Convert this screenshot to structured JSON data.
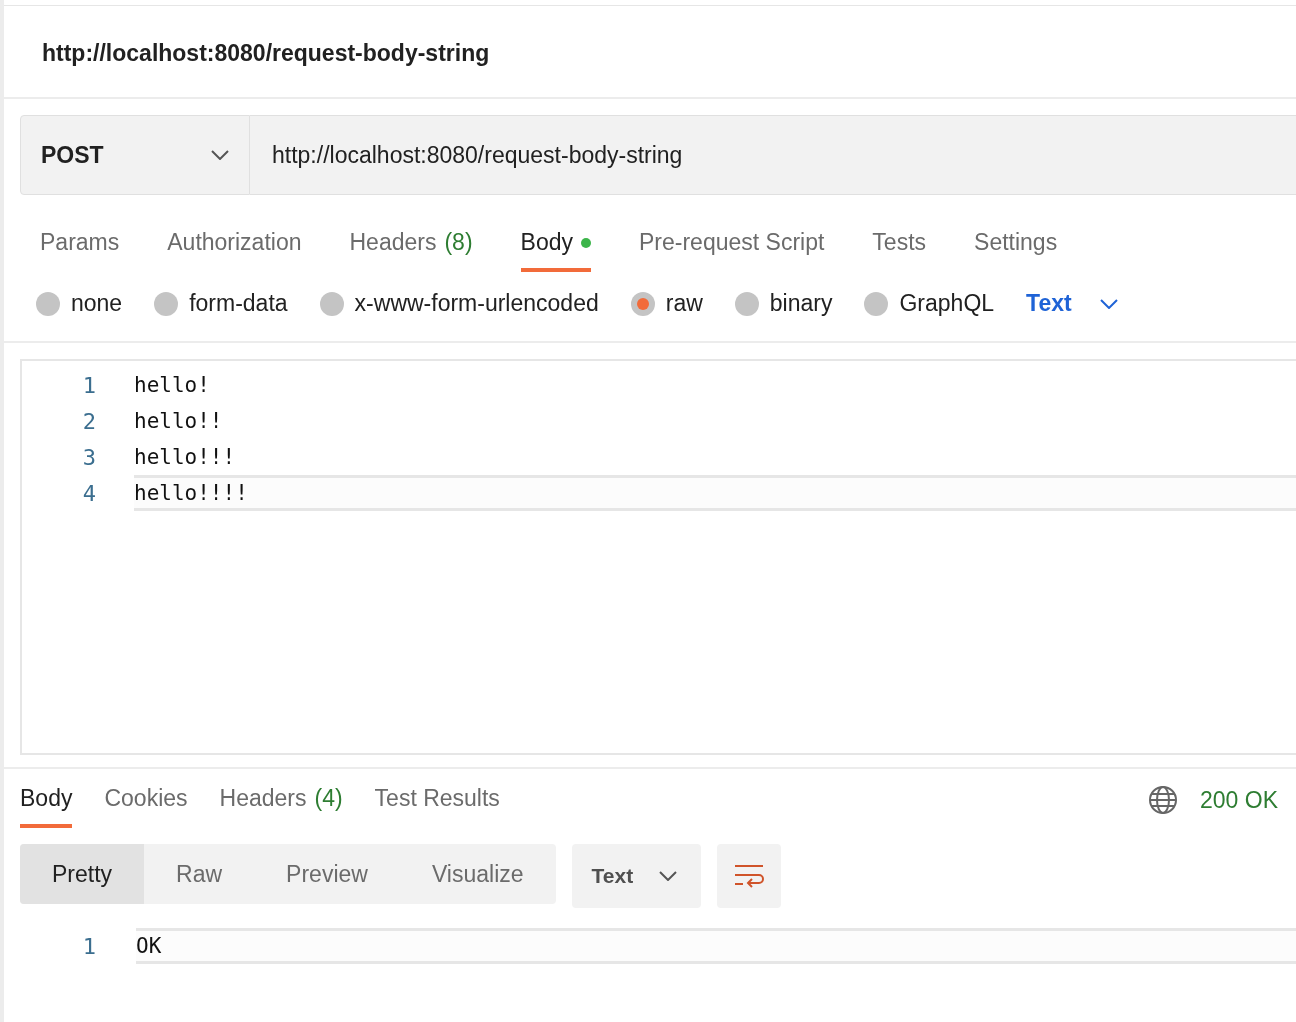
{
  "request_title": "http://localhost:8080/request-body-string",
  "method": "POST",
  "url": "http://localhost:8080/request-body-string",
  "request_tabs": [
    {
      "label": "Params",
      "selected": false
    },
    {
      "label": "Authorization",
      "selected": false
    },
    {
      "label": "Headers",
      "count": "(8)",
      "selected": false
    },
    {
      "label": "Body",
      "dot": true,
      "selected": true
    },
    {
      "label": "Pre-request Script",
      "selected": false
    },
    {
      "label": "Tests",
      "selected": false
    },
    {
      "label": "Settings",
      "selected": false
    }
  ],
  "body_types": [
    {
      "label": "none",
      "selected": false
    },
    {
      "label": "form-data",
      "selected": false
    },
    {
      "label": "x-www-form-urlencoded",
      "selected": false
    },
    {
      "label": "raw",
      "selected": true
    },
    {
      "label": "binary",
      "selected": false
    },
    {
      "label": "GraphQL",
      "selected": false
    }
  ],
  "body_format": "Text",
  "editor_lines": [
    {
      "number": "1",
      "text": "hello!",
      "active": false
    },
    {
      "number": "2",
      "text": "hello!!",
      "active": false
    },
    {
      "number": "3",
      "text": "hello!!!",
      "active": false
    },
    {
      "number": "4",
      "text": "hello!!!!",
      "active": true
    }
  ],
  "response_tabs": [
    {
      "label": "Body",
      "selected": true
    },
    {
      "label": "Cookies",
      "selected": false
    },
    {
      "label": "Headers",
      "count": "(4)",
      "selected": false
    },
    {
      "label": "Test Results",
      "selected": false
    }
  ],
  "status": "200 OK",
  "view_modes": [
    {
      "label": "Pretty",
      "selected": true
    },
    {
      "label": "Raw",
      "selected": false
    },
    {
      "label": "Preview",
      "selected": false
    },
    {
      "label": "Visualize",
      "selected": false
    }
  ],
  "response_format": "Text",
  "response_lines": [
    {
      "number": "1",
      "text": "OK",
      "active": true
    }
  ]
}
